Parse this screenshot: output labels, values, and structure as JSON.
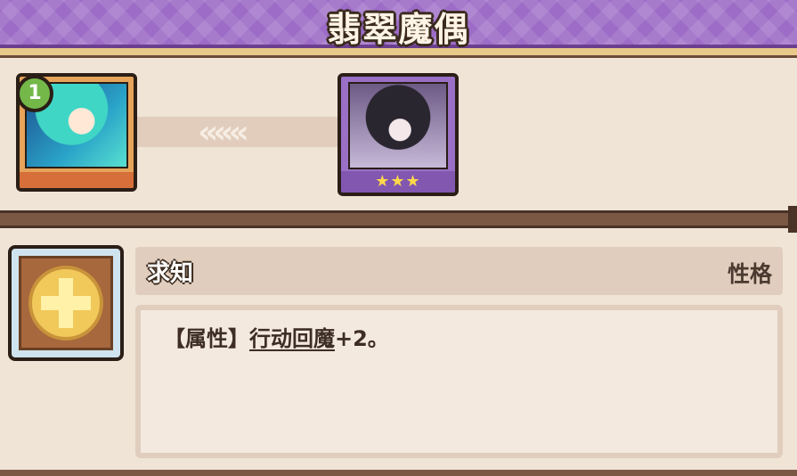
{
  "header": {
    "title": "翡翠魔偶"
  },
  "transform": {
    "arrows_glyph": "«««",
    "from": {
      "level": "1",
      "portrait_icon": "teal-haired-girl-portrait"
    },
    "to": {
      "stars": "★★★",
      "portrait_icon": "dark-haired-girl-portrait"
    }
  },
  "trait": {
    "icon": "plus-icon",
    "name": "求知",
    "type": "性格",
    "desc_prefix": "【属性】",
    "desc_link": "行动回魔",
    "desc_suffix": "+2。"
  },
  "colors": {
    "header": "#9c6cc6",
    "panel": "#efe4d6",
    "name_bar": "#e1cdbd",
    "level_badge": "#74b84a",
    "stars": "#ffd84a"
  }
}
